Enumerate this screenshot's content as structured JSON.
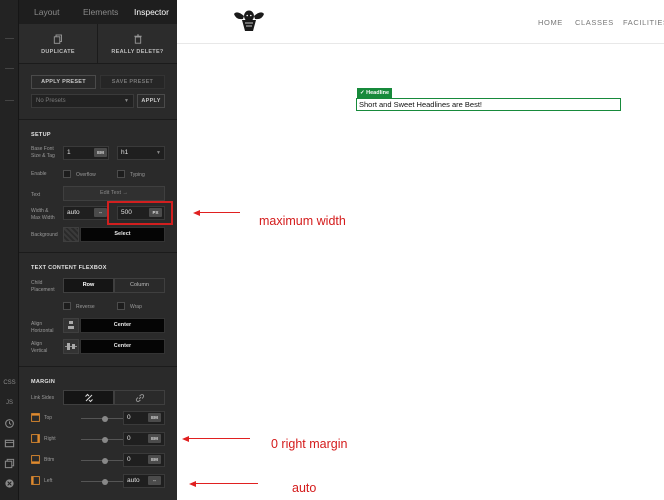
{
  "rail": {
    "css": "CSS",
    "js": "JS"
  },
  "tabs": {
    "layout": "Layout",
    "elements": "Elements",
    "inspector": "Inspector"
  },
  "actions": {
    "duplicate": "DUPLICATE",
    "delete": "REALLY DELETE?"
  },
  "preset": {
    "apply": "APPLY PRESET",
    "save": "SAVE PRESET",
    "select_value": "No Presets",
    "apply_small": "APPLY"
  },
  "setup": {
    "title": "SETUP",
    "font_label_1": "Base Font",
    "font_label_2": "Size & Tag",
    "font_value": "1",
    "font_unit": "EM",
    "tag_value": "h1",
    "enable_label": "Enable",
    "overflow": "Overflow",
    "typing": "Typing",
    "text_label": "Text",
    "edit_text": "Edit Text →",
    "width_label_1": "Width &",
    "width_label_2": "Max Width",
    "width_value": "auto",
    "width_unit": "--",
    "max_value": "500",
    "max_unit": "PX",
    "bg_label": "Background",
    "bg_select": "Select"
  },
  "flexbox": {
    "title": "TEXT CONTENT FLEXBOX",
    "child_label_1": "Child",
    "child_label_2": "Placement",
    "row": "Row",
    "column": "Column",
    "reverse": "Reverse",
    "wrap": "Wrap",
    "alignh_label_1": "Align",
    "alignh_label_2": "Horizontal",
    "alignh_value": "Center",
    "alignv_label_1": "Align",
    "alignv_label_2": "Vertical",
    "alignv_value": "Center"
  },
  "margin": {
    "title": "MARGIN",
    "link_label": "Link Sides",
    "rows": [
      {
        "label": "Top",
        "value": "0",
        "unit": "EM",
        "level": 0.5
      },
      {
        "label": "Right",
        "value": "0",
        "unit": "EM",
        "level": 0.5
      },
      {
        "label": "Bttm",
        "value": "0",
        "unit": "EM",
        "level": 0.5
      },
      {
        "label": "Left",
        "value": "auto",
        "unit": "--",
        "level": 0.5
      }
    ]
  },
  "site": {
    "nav": [
      "HOME",
      "CLASSES",
      "FACILITIES"
    ],
    "badge": "✓ Headline",
    "headline": "Short and Sweet Headlines are Best!"
  },
  "annotations": {
    "max_width": "maximum width",
    "right_margin": "0 right margin",
    "auto": "auto"
  },
  "colors": {
    "accent_green": "#178a3b",
    "annotation_red": "#d41b1b",
    "panel_bg": "#2a2a2a"
  }
}
